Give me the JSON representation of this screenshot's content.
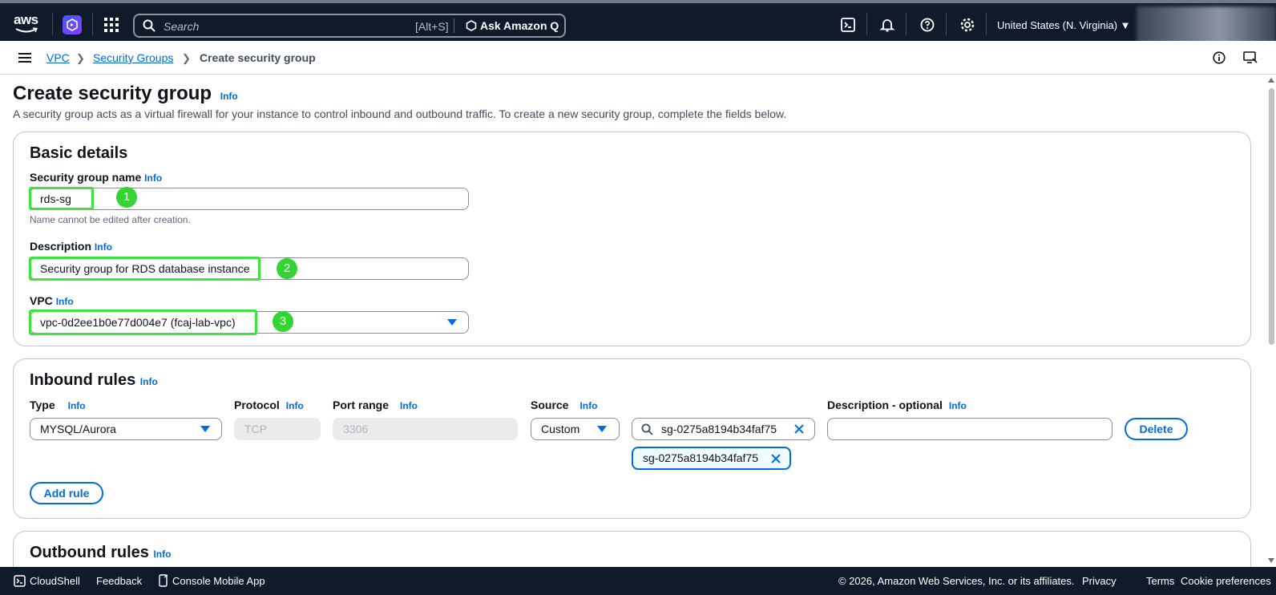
{
  "topnav": {
    "logo_text": "aws",
    "search_placeholder": "Search",
    "search_shortcut": "[Alt+S]",
    "ask_q_label": "Ask Amazon Q",
    "region_label": "United States (N. Virginia)",
    "icons": [
      "cloudshell-icon",
      "bell-icon",
      "help-icon",
      "settings-icon"
    ]
  },
  "breadcrumb": {
    "items": [
      "VPC",
      "Security Groups",
      "Create security group"
    ]
  },
  "page": {
    "title": "Create security group",
    "info": "Info",
    "description": "A security group acts as a virtual firewall for your instance to control inbound and outbound traffic. To create a new security group, complete the fields below."
  },
  "basic": {
    "heading": "Basic details",
    "name_label": "Security group name",
    "name_value": "rds-sg",
    "name_hint": "Name cannot be edited after creation.",
    "desc_label": "Description",
    "desc_value": "Security group for RDS database instance",
    "vpc_label": "VPC",
    "vpc_value": "vpc-0d2ee1b0e77d004e7 (fcaj-lab-vpc)",
    "info": "Info",
    "badges": [
      "1",
      "2",
      "3"
    ]
  },
  "inbound": {
    "heading": "Inbound rules",
    "info": "Info",
    "columns": [
      "Type",
      "Protocol",
      "Port range",
      "Source",
      "Description - optional"
    ],
    "rule": {
      "type": "MYSQL/Aurora",
      "protocol": "TCP",
      "port_range": "3306",
      "source": "Custom",
      "source_search": "sg-0275a8194b34faf75",
      "source_token": "sg-0275a8194b34faf75",
      "description": ""
    },
    "delete_label": "Delete",
    "add_rule_label": "Add rule"
  },
  "outbound": {
    "heading": "Outbound rules",
    "info": "Info"
  },
  "footer": {
    "cloudshell": "CloudShell",
    "feedback": "Feedback",
    "mobile_app": "Console Mobile App",
    "copyright": "© 2026, Amazon Web Services, Inc. or its affiliates.",
    "privacy": "Privacy",
    "terms": "Terms",
    "cookie": "Cookie preferences"
  },
  "colors": {
    "nav_bg": "#0f1b2a",
    "link": "#006ce0",
    "highlight": "#3fe33f"
  }
}
